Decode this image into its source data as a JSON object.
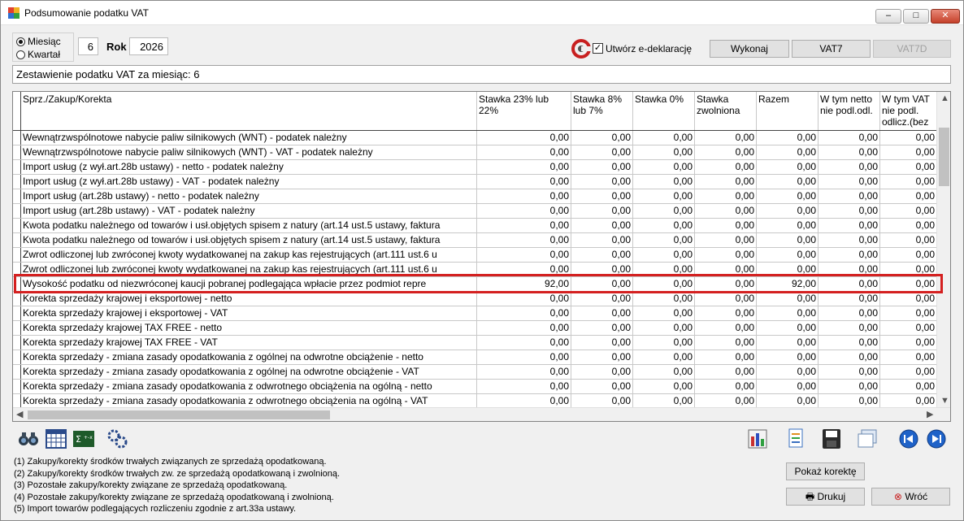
{
  "window": {
    "title": "Podsumowanie podatku VAT",
    "minimize_label": "‒",
    "maximize_label": "□",
    "close_label": "✕"
  },
  "period": {
    "options": [
      "Miesiąc",
      "Kwartał"
    ],
    "selected": "Miesiąc",
    "month_value": "6",
    "year_label": "Rok",
    "year_value": "2026"
  },
  "toolbar": {
    "edeklaracja_label": "Utwórz e-deklarację",
    "edeklaracja_checked": true,
    "execute_label": "Wykonaj",
    "vat7_label": "VAT7",
    "vat7d_label": "VAT7D"
  },
  "summary_title": "Zestawienie podatku VAT za miesiąc: 6",
  "table": {
    "columns": [
      "Sprz./Zakup/Korekta",
      "Stawka 23% lub 22%",
      "Stawka 8% lub 7%",
      "Stawka 0%",
      "Stawka zwolniona",
      "Razem",
      "W tym netto nie podl.odl.",
      "W tym VAT nie podl. odlicz.(bez"
    ],
    "rows": [
      {
        "name": "Wewnątrzwspólnotowe nabycie paliw silnikowych (WNT) - podatek należny",
        "values": [
          "0,00",
          "0,00",
          "0,00",
          "0,00",
          "0,00",
          "0,00",
          "0,00"
        ]
      },
      {
        "name": "Wewnątrzwspólnotowe nabycie paliw silnikowych (WNT) - VAT - podatek należny",
        "values": [
          "0,00",
          "0,00",
          "0,00",
          "0,00",
          "0,00",
          "0,00",
          "0,00"
        ]
      },
      {
        "name": "Import usług (z wył.art.28b ustawy) - netto - podatek należny",
        "values": [
          "0,00",
          "0,00",
          "0,00",
          "0,00",
          "0,00",
          "0,00",
          "0,00"
        ]
      },
      {
        "name": "Import usług (z wył.art.28b ustawy) - VAT - podatek należny",
        "values": [
          "0,00",
          "0,00",
          "0,00",
          "0,00",
          "0,00",
          "0,00",
          "0,00"
        ]
      },
      {
        "name": "Import usług (art.28b ustawy) - netto - podatek należny",
        "values": [
          "0,00",
          "0,00",
          "0,00",
          "0,00",
          "0,00",
          "0,00",
          "0,00"
        ]
      },
      {
        "name": "Import usług  (art.28b ustawy) - VAT - podatek należny",
        "values": [
          "0,00",
          "0,00",
          "0,00",
          "0,00",
          "0,00",
          "0,00",
          "0,00"
        ]
      },
      {
        "name": "Kwota podatku należnego od towarów i usł.objętych spisem z natury (art.14 ust.5 ustawy,  faktura",
        "values": [
          "0,00",
          "0,00",
          "0,00",
          "0,00",
          "0,00",
          "0,00",
          "0,00"
        ]
      },
      {
        "name": "Kwota podatku należnego od towarów i usł.objętych spisem z natury (art.14 ust.5 ustawy,  faktura",
        "values": [
          "0,00",
          "0,00",
          "0,00",
          "0,00",
          "0,00",
          "0,00",
          "0,00"
        ]
      },
      {
        "name": "Zwrot odliczonej lub zwróconej kwoty wydatkowanej na zakup kas rejestrujących (art.111 ust.6 u",
        "values": [
          "0,00",
          "0,00",
          "0,00",
          "0,00",
          "0,00",
          "0,00",
          "0,00"
        ]
      },
      {
        "name": "Zwrot odliczonej lub zwróconej kwoty wydatkowanej na zakup kas rejestrujących (art.111 ust.6 u",
        "values": [
          "0,00",
          "0,00",
          "0,00",
          "0,00",
          "0,00",
          "0,00",
          "0,00"
        ]
      },
      {
        "name": "Wysokość podatku od niezwróconej kaucji pobranej podlegająca wpłacie przez podmiot repre",
        "values": [
          "92,00",
          "0,00",
          "0,00",
          "0,00",
          "92,00",
          "0,00",
          "0,00"
        ],
        "highlighted": true
      },
      {
        "name": "Korekta sprzedaży krajowej i eksportowej - netto",
        "values": [
          "0,00",
          "0,00",
          "0,00",
          "0,00",
          "0,00",
          "0,00",
          "0,00"
        ]
      },
      {
        "name": "Korekta sprzedaży krajowej i eksportowej - VAT",
        "values": [
          "0,00",
          "0,00",
          "0,00",
          "0,00",
          "0,00",
          "0,00",
          "0,00"
        ]
      },
      {
        "name": "Korekta sprzedaży krajowej TAX FREE - netto",
        "values": [
          "0,00",
          "0,00",
          "0,00",
          "0,00",
          "0,00",
          "0,00",
          "0,00"
        ]
      },
      {
        "name": "Korekta sprzedaży krajowej TAX FREE - VAT",
        "values": [
          "0,00",
          "0,00",
          "0,00",
          "0,00",
          "0,00",
          "0,00",
          "0,00"
        ]
      },
      {
        "name": "Korekta sprzedaży - zmiana zasady opodatkowania z ogólnej na odwrotne obciążenie - netto",
        "values": [
          "0,00",
          "0,00",
          "0,00",
          "0,00",
          "0,00",
          "0,00",
          "0,00"
        ]
      },
      {
        "name": "Korekta sprzedaży - zmiana zasady opodatkowania z ogólnej na odwrotne obciążenie - VAT",
        "values": [
          "0,00",
          "0,00",
          "0,00",
          "0,00",
          "0,00",
          "0,00",
          "0,00"
        ]
      },
      {
        "name": "Korekta sprzedaży - zmiana zasady opodatkowania z odwrotnego obciążenia na ogólną - netto",
        "values": [
          "0,00",
          "0,00",
          "0,00",
          "0,00",
          "0,00",
          "0,00",
          "0,00"
        ]
      },
      {
        "name": "Korekta sprzedaży - zmiana zasady opodatkowania z odwrotnego obciążenia na ogólną - VAT",
        "values": [
          "0,00",
          "0,00",
          "0,00",
          "0,00",
          "0,00",
          "0,00",
          "0,00"
        ]
      }
    ]
  },
  "bottom_tools": [
    "binoculars-icon",
    "calendar-grid-icon",
    "formula-icon",
    "gears-icon"
  ],
  "right_tools": [
    "chart-icon",
    "document-export-icon",
    "save-icon",
    "copy-icon",
    "prev-icon",
    "next-icon"
  ],
  "legend": [
    "(1) Zakupy/korekty środków trwałych związanych ze sprzedażą opodatkowaną.",
    "(2) Zakupy/korekty środków trwałych zw. ze sprzedażą opodatkowaną i zwolnioną.",
    "(3) Pozostałe zakupy/korekty związane ze sprzedażą opodatkowaną.",
    "(4) Pozostałe zakupy/korekty związane ze sprzedażą opodatkowaną i zwolnioną.",
    "(5) Import towarów podlegających rozliczeniu zgodnie z art.33a ustawy."
  ],
  "buttons": {
    "show_correction": "Pokaż korektę",
    "print": "Drukuj",
    "back": "Wróć"
  },
  "colors": {
    "highlight": "#d42020",
    "close_button": "#c5402a"
  }
}
